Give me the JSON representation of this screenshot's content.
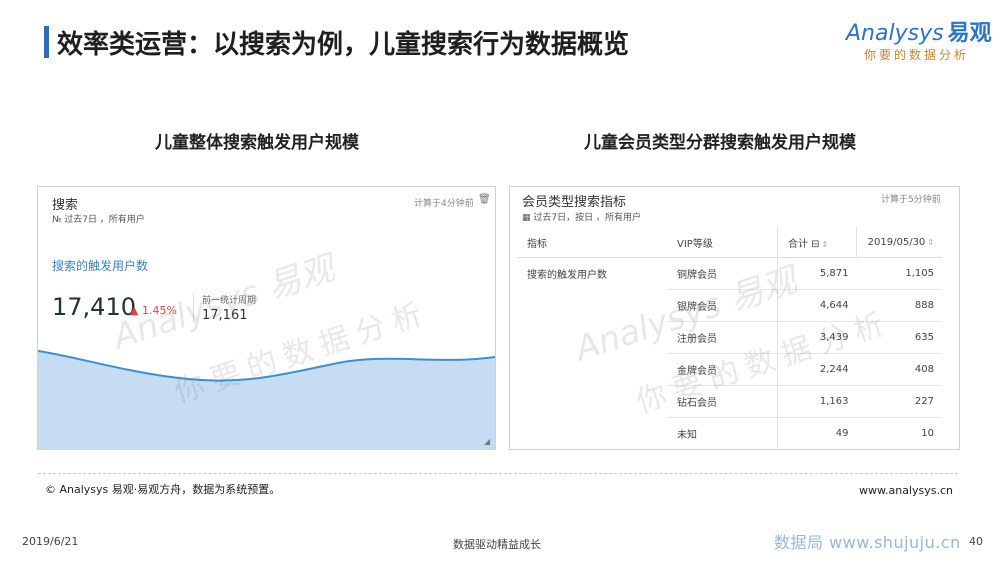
{
  "header": {
    "title": "效率类运营：以搜索为例，儿童搜索行为数据概览",
    "logo_brand": "Analysys",
    "logo_cn": "易观",
    "logo_tagline": "你要的数据分析"
  },
  "sections": {
    "left_title": "儿童整体搜索触发用户规模",
    "right_title": "儿童会员类型分群搜索触发用户规模"
  },
  "left_panel": {
    "title": "搜索",
    "subtitle": "№ 过去7日 ，所有用户",
    "meta": "计算于4分钟前",
    "metric_label": "搜索的触发用户数",
    "metric_value": "17,410",
    "change": "▲ 1.45%",
    "prev_label": "前一统计周期",
    "prev_value": "17,161"
  },
  "right_panel": {
    "title": "会员类型搜索指标",
    "subtitle": "▦ 过去7日，按日 ，所有用户",
    "meta": "计算于5分钟前",
    "columns": [
      "指标",
      "VIP等级",
      "合计 ⊟",
      "2019/05/30"
    ],
    "metric_name": "搜索的触发用户数",
    "rows": [
      {
        "level": "铜牌会员",
        "total": "5,871",
        "day": "1,105"
      },
      {
        "level": "银牌会员",
        "total": "4,644",
        "day": "888"
      },
      {
        "level": "注册会员",
        "total": "3,439",
        "day": "635"
      },
      {
        "level": "金牌会员",
        "total": "2,244",
        "day": "408"
      },
      {
        "level": "钻石会员",
        "total": "1,163",
        "day": "227"
      },
      {
        "level": "未知",
        "total": "49",
        "day": "10"
      }
    ]
  },
  "watermark": {
    "brand": "Analysys 易观",
    "tagline": "你要的数据分析"
  },
  "footer": {
    "note": "© Analysys 易观·易观方舟，数据为系统预置。",
    "url": "www.analysys.cn",
    "date": "2019/6/21",
    "center": "数据驱动精益成长",
    "site_watermark": "数据局 www.shujuju.cn",
    "page": "40"
  },
  "colors": {
    "accent": "#2f6db5",
    "area_fill": "#c5dcf2",
    "area_line": "#3a8fd6",
    "up_red": "#e04545"
  }
}
